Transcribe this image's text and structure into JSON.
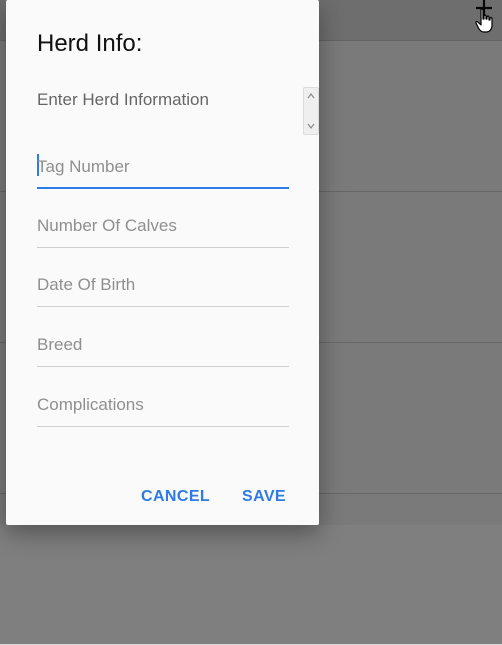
{
  "dialog": {
    "title": "Herd Info:",
    "message": "Enter Herd Information",
    "fields": [
      {
        "placeholder": "Tag Number",
        "value": "",
        "focused": true
      },
      {
        "placeholder": "Number Of Calves",
        "value": "",
        "focused": false
      },
      {
        "placeholder": "Date Of Birth",
        "value": "",
        "focused": false
      },
      {
        "placeholder": "Breed",
        "value": "",
        "focused": false
      },
      {
        "placeholder": "Complications",
        "value": "",
        "focused": false
      }
    ],
    "buttons": {
      "cancel": "CANCEL",
      "save": "SAVE"
    }
  },
  "colors": {
    "accent": "#2e7be6",
    "scrim": "#000000",
    "dialog_bg": "#fafafa"
  },
  "icons": {
    "add": "plus-icon",
    "cursor": "hand-pointer-icon",
    "scroll_up": "chevron-up-icon",
    "scroll_down": "chevron-down-icon"
  }
}
